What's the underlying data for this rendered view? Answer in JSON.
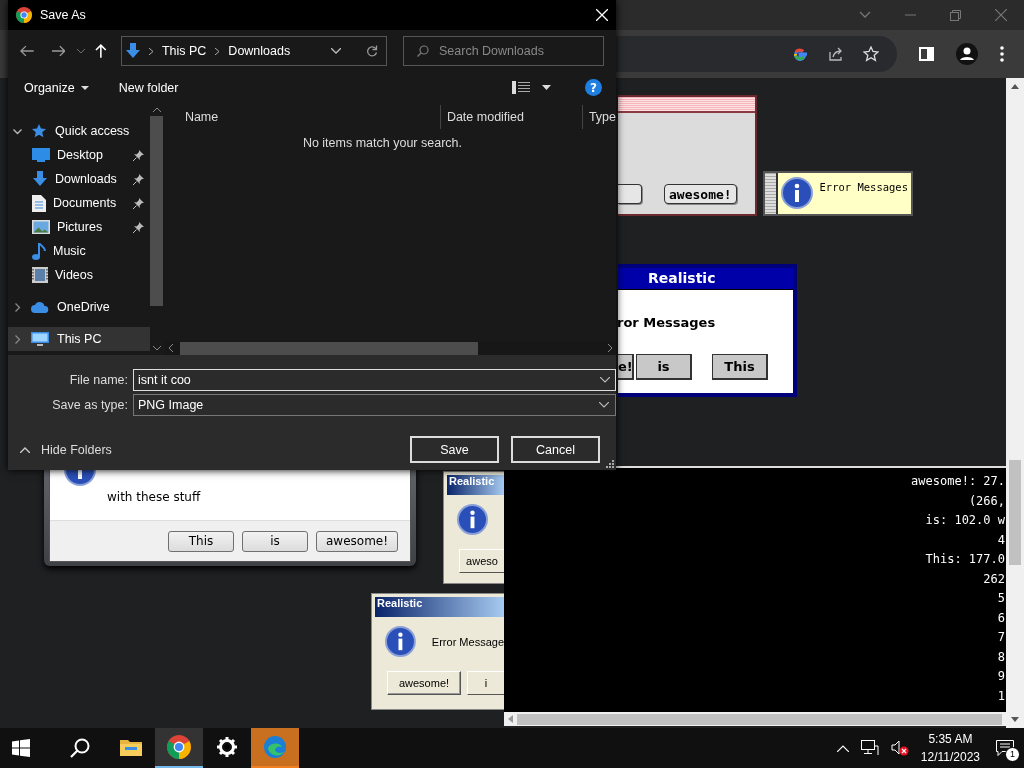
{
  "save_dialog": {
    "title": "Save As",
    "path": [
      "This PC",
      "Downloads"
    ],
    "search": {
      "placeholder": "Search Downloads"
    },
    "toolbar": [
      "Organize",
      "New folder"
    ],
    "help": "?",
    "nav": [
      {
        "label": "Quick access",
        "expanded": true,
        "selected": false,
        "children": [
          {
            "label": "Desktop",
            "pinned": true,
            "selected": false
          },
          {
            "label": "Downloads",
            "pinned": true,
            "selected": false
          },
          {
            "label": "Documents",
            "pinned": true,
            "selected": false
          },
          {
            "label": "Pictures",
            "pinned": true,
            "selected": false
          },
          {
            "label": "Music",
            "pinned": false,
            "selected": false
          },
          {
            "label": "Videos",
            "pinned": false,
            "selected": false
          }
        ]
      },
      {
        "label": "OneDrive",
        "expanded": false,
        "selected": false
      },
      {
        "label": "This PC",
        "expanded": false,
        "selected": true
      }
    ],
    "columns": [
      "Name",
      "Date modified",
      "Type"
    ],
    "empty_message": "No items match your search.",
    "file_name": {
      "label": "File name:",
      "value": "isnt it coo"
    },
    "save_type": {
      "label": "Save as type:",
      "value": "PNG Image"
    },
    "hide_folders": "Hide Folders",
    "buttons": [
      "Save",
      "Cancel"
    ]
  },
  "demo_windows": [
    {
      "kind": "mac",
      "buttons": [
        "awesome!"
      ]
    },
    {
      "kind": "note",
      "message": "Error Messages"
    },
    {
      "kind": "win31",
      "title": "Realistic",
      "message": "ror Messages",
      "buttons": [
        "e!",
        "is",
        "This"
      ]
    },
    {
      "kind": "win7",
      "message": "with these stuff",
      "buttons": [
        "This",
        "is",
        "awesome!"
      ]
    },
    {
      "kind": "xp",
      "title": "Realistic",
      "buttons": [
        "aweso"
      ]
    },
    {
      "kind": "xp",
      "title": "Realistic",
      "message": "Error Message",
      "buttons": [
        "awesome!",
        "i"
      ]
    }
  ],
  "console": {
    "lines": [
      "awesome!: 27.",
      "(266,",
      "is: 102.0 w",
      "4",
      "This: 177.0",
      "262",
      "5",
      "6",
      "7",
      "8",
      "9",
      "1"
    ]
  },
  "taskbar": {
    "apps": [
      {
        "active": false,
        "attention": false
      },
      {
        "active": true,
        "attention": false
      },
      {
        "active": false,
        "attention": false
      },
      {
        "active": false,
        "attention": true
      }
    ],
    "muted": true,
    "time": "5:35 AM",
    "date": "12/11/2023",
    "notifications": "1"
  }
}
